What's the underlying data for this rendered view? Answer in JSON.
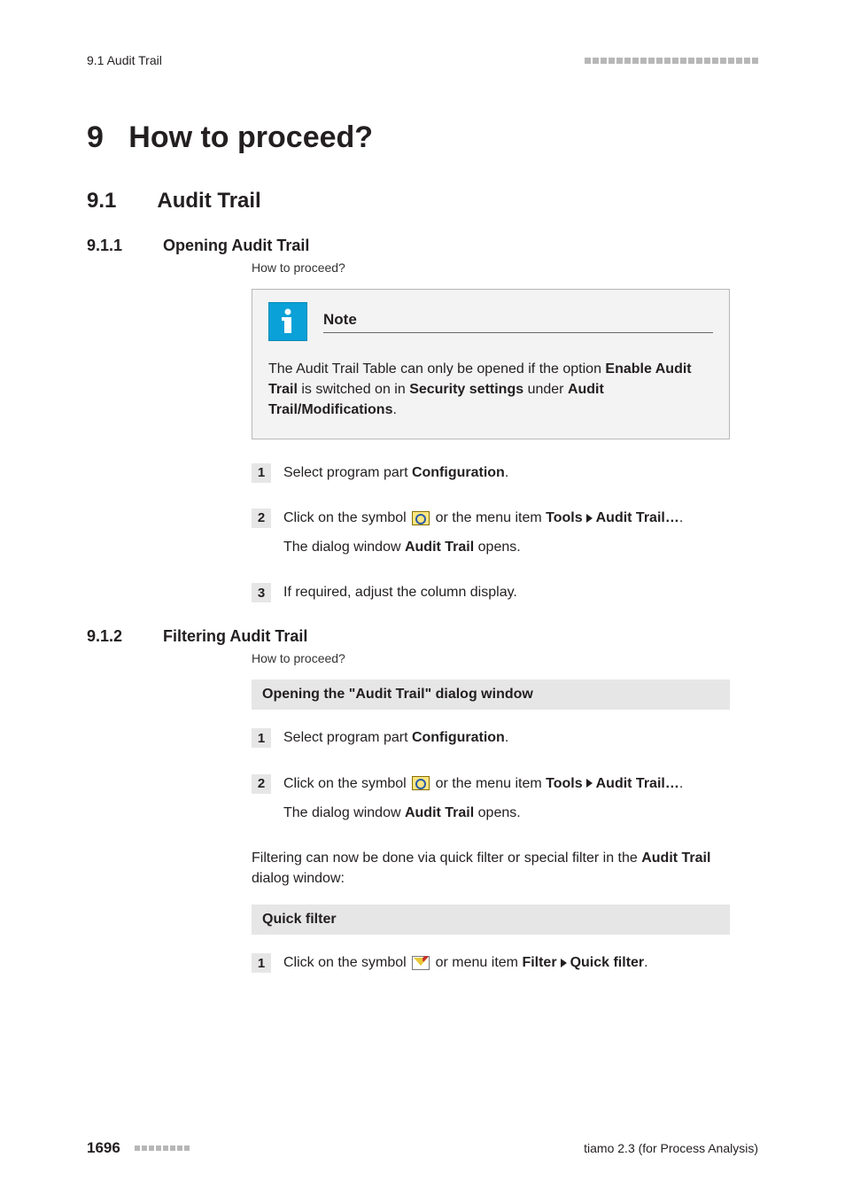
{
  "runningHead": {
    "left": "9.1 Audit Trail"
  },
  "h1": {
    "num": "9",
    "title": "How to proceed?"
  },
  "h2": {
    "num": "9.1",
    "title": "Audit Trail"
  },
  "s911": {
    "num": "9.1.1",
    "title": "Opening Audit Trail",
    "crumb": "How to proceed?",
    "note": {
      "label": "Note",
      "t1": "The Audit Trail Table can only be opened if the option ",
      "b1": "Enable Audit Trail",
      "t2": " is switched on in ",
      "b2": "Security settings",
      "t3": " under ",
      "b3": "Audit Trail/Modifications",
      "t4": "."
    },
    "steps": [
      {
        "num": "1",
        "pre": "Select program part ",
        "bold": "Configuration",
        "post": "."
      },
      {
        "num": "2",
        "a_pre": "Click on the symbol ",
        "a_mid": " or the menu item ",
        "a_b1": "Tools",
        "a_b2": "Audit Trail…",
        "a_post": ".",
        "b_pre": "The dialog window ",
        "b_b": "Audit Trail",
        "b_post": " opens."
      },
      {
        "num": "3",
        "plain": "If required, adjust the column display."
      }
    ]
  },
  "s912": {
    "num": "9.1.2",
    "title": "Filtering Audit Trail",
    "crumb": "How to proceed?",
    "bar1": "Opening the \"Audit Trail\" dialog window",
    "steps": [
      {
        "num": "1",
        "pre": "Select program part ",
        "bold": "Configuration",
        "post": "."
      },
      {
        "num": "2",
        "a_pre": "Click on the symbol ",
        "a_mid": " or the menu item ",
        "a_b1": "Tools",
        "a_b2": "Audit Trail…",
        "a_post": ".",
        "b_pre": "The dialog window ",
        "b_b": "Audit Trail",
        "b_post": " opens."
      }
    ],
    "para": {
      "t1": "Filtering can now be done via quick filter or special filter in the ",
      "b1": "Audit Trail",
      "t2": " dialog window:"
    },
    "bar2": "Quick filter",
    "qf": {
      "num": "1",
      "pre": "Click on the symbol ",
      "mid": " or menu item ",
      "b1": "Filter",
      "b2": "Quick filter",
      "post": "."
    }
  },
  "footer": {
    "page": "1696",
    "right": "tiamo 2.3 (for Process Analysis)"
  }
}
